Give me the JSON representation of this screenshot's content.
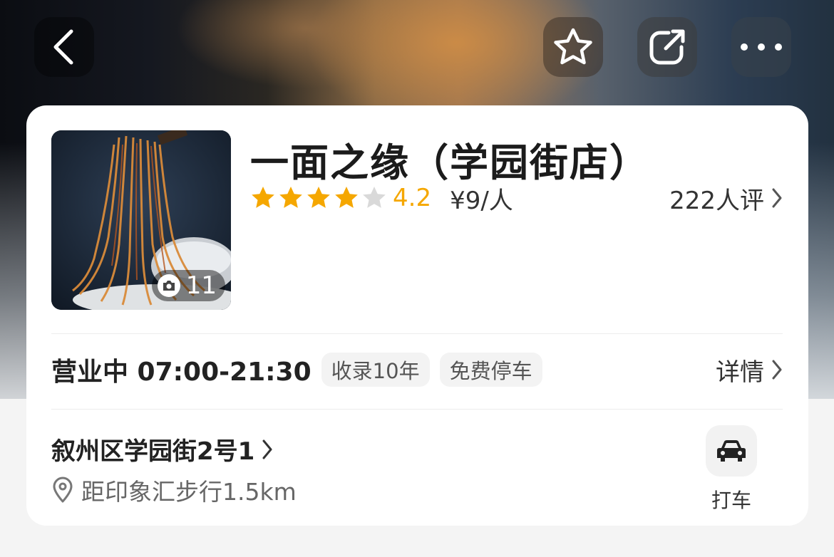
{
  "shop": {
    "name": "一面之缘（学园街店）",
    "rating": 4.2,
    "rating_text": "4.2",
    "price": "¥9/人",
    "reviews": "222人评",
    "photo_count": "11"
  },
  "hours": {
    "text": "营业中 07:00-21:30",
    "tags": [
      "收录10年",
      "免费停车"
    ],
    "details_label": "详情"
  },
  "location": {
    "address": "叙州区学园街2号1",
    "distance": "距印象汇步行1.5km",
    "taxi_label": "打车"
  },
  "colors": {
    "star_active": "#f5a700",
    "star_inactive": "#d9d9d9"
  },
  "icons": [
    "back-icon",
    "star-outline-icon",
    "share-icon",
    "more-icon",
    "camera-icon",
    "chevron-right-icon",
    "location-pin-icon",
    "car-icon"
  ]
}
